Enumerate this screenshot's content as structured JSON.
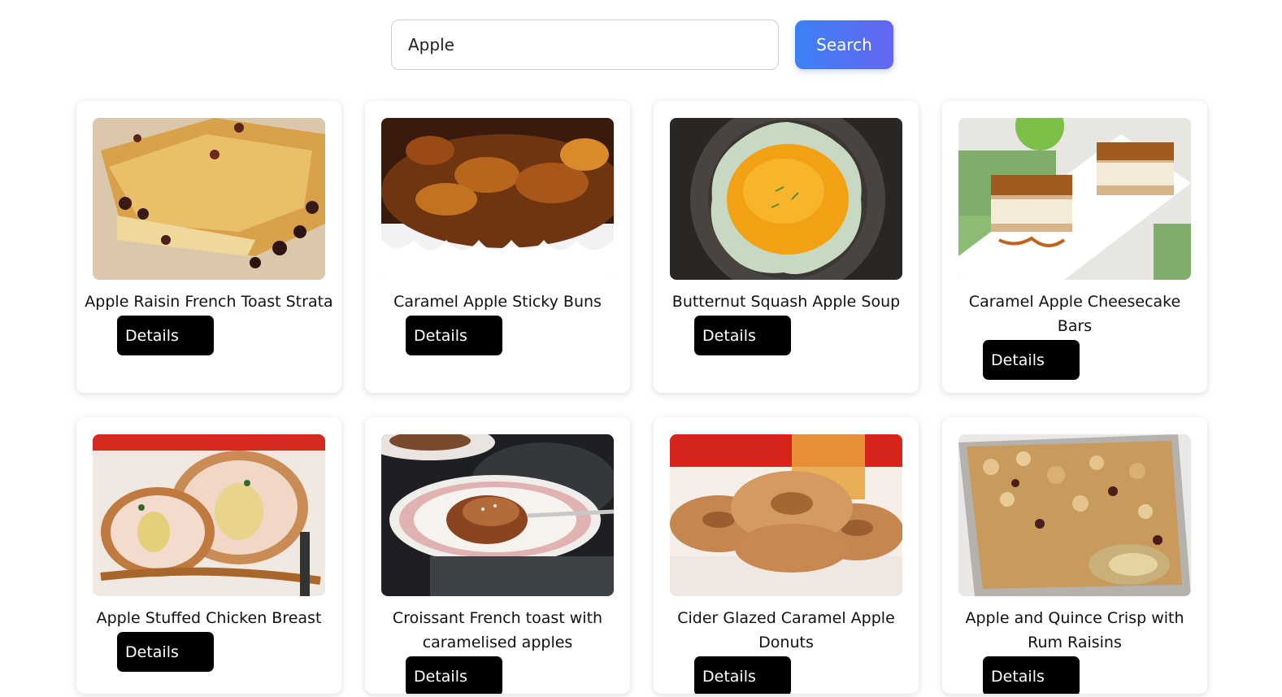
{
  "search": {
    "value": "Apple",
    "button_label": "Search"
  },
  "recipes": [
    {
      "title": "Apple Raisin French Toast Strata",
      "details_label": "Details"
    },
    {
      "title": "Caramel Apple Sticky Buns",
      "details_label": "Details"
    },
    {
      "title": "Butternut Squash Apple Soup",
      "details_label": "Details"
    },
    {
      "title": "Caramel Apple Cheesecake Bars",
      "details_label": "Details"
    },
    {
      "title": "Apple Stuffed Chicken Breast",
      "details_label": "Details"
    },
    {
      "title": "Croissant French toast with caramelised apples",
      "details_label": "Details"
    },
    {
      "title": "Cider Glazed Caramel Apple Donuts",
      "details_label": "Details"
    },
    {
      "title": "Apple and Quince Crisp with Rum Raisins",
      "details_label": "Details"
    }
  ],
  "colors": {
    "search_gradient_start": "#3b82f6",
    "search_gradient_end": "#6366f1",
    "details_button": "#000000"
  }
}
